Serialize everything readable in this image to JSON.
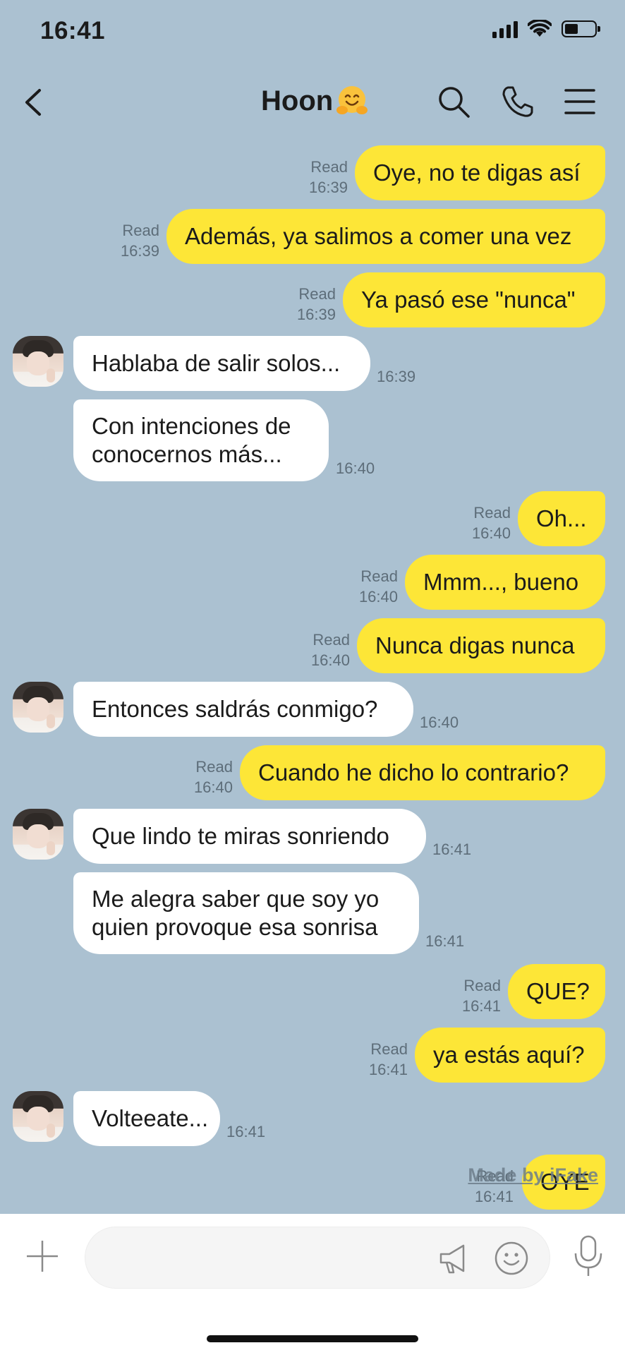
{
  "status_bar": {
    "time": "16:41"
  },
  "header": {
    "title": "Hoon",
    "icons": [
      "back-arrow-icon",
      "hugging-face-emoji",
      "search-icon",
      "phone-icon",
      "menu-icon"
    ]
  },
  "messages": [
    {
      "side": "out",
      "text": "Oye, no te digas así",
      "read": "Read",
      "time": "16:39"
    },
    {
      "side": "out",
      "text": "Además, ya salimos a comer una vez",
      "read": "Read",
      "time": "16:39"
    },
    {
      "side": "out",
      "text": "Ya pasó ese \"nunca\"",
      "read": "Read",
      "time": "16:39"
    },
    {
      "side": "in",
      "text": "Hablaba de salir solos...",
      "time": "16:39"
    },
    {
      "side": "in",
      "lines": [
        "Con intenciones de",
        "conocernos más..."
      ],
      "time": "16:40"
    },
    {
      "side": "out",
      "text": "Oh...",
      "read": "Read",
      "time": "16:40"
    },
    {
      "side": "out",
      "text": "Mmm..., bueno",
      "read": "Read",
      "time": "16:40"
    },
    {
      "side": "out",
      "text": "Nunca digas nunca",
      "read": "Read",
      "time": "16:40"
    },
    {
      "side": "in",
      "text": "Entonces saldrás conmigo?",
      "time": "16:40"
    },
    {
      "side": "out",
      "text": "Cuando he dicho lo contrario?",
      "read": "Read",
      "time": "16:40"
    },
    {
      "side": "in",
      "text": "Que lindo te miras sonriendo",
      "time": "16:41"
    },
    {
      "side": "in",
      "lines": [
        "Me alegra saber que soy yo",
        "quien provoque esa sonrisa"
      ],
      "time": "16:41"
    },
    {
      "side": "out",
      "text": "QUE?",
      "read": "Read",
      "time": "16:41"
    },
    {
      "side": "out",
      "text": "ya estás aquí?",
      "read": "Read",
      "time": "16:41"
    },
    {
      "side": "in",
      "text": "Volteeate...",
      "time": "16:41"
    },
    {
      "side": "out",
      "text": "OYE",
      "read": "Read",
      "time": "16:41"
    }
  ],
  "watermark": "Made by iFake",
  "input_bar": {
    "placeholder": "",
    "icons": [
      "plus-icon",
      "megaphone-icon",
      "emoji-icon",
      "microphone-icon"
    ]
  },
  "colors": {
    "background": "#abc1d1",
    "outgoing_bubble": "#fde637",
    "incoming_bubble": "#ffffff",
    "meta_text": "#5d6d79"
  }
}
